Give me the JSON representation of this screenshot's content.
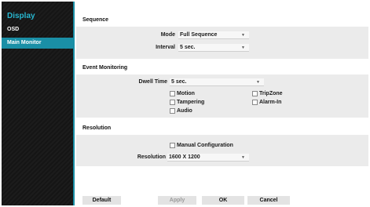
{
  "sidebar": {
    "title": "Display",
    "items": [
      {
        "label": "OSD",
        "active": false
      },
      {
        "label": "Main Monitor",
        "active": true
      }
    ]
  },
  "sequence": {
    "title": "Sequence",
    "mode_label": "Mode",
    "mode_value": "Full Sequence",
    "interval_label": "Interval",
    "interval_value": "5 sec."
  },
  "event_monitoring": {
    "title": "Event Monitoring",
    "dwell_label": "Dwell Time",
    "dwell_value": "5 sec.",
    "options": [
      {
        "label": "Motion",
        "checked": false
      },
      {
        "label": "TripZone",
        "checked": false
      },
      {
        "label": "Tampering",
        "checked": false
      },
      {
        "label": "Alarm-In",
        "checked": false
      },
      {
        "label": "Audio",
        "checked": false
      }
    ]
  },
  "resolution": {
    "title": "Resolution",
    "manual_label": "Manual Configuration",
    "manual_checked": false,
    "resolution_label": "Resolution",
    "resolution_value": "1600 X 1200"
  },
  "footer": {
    "default_label": "Default",
    "apply_label": "Apply",
    "ok_label": "OK",
    "cancel_label": "Cancel"
  },
  "colors": {
    "accent": "#1a8fa6",
    "title": "#27b6cf",
    "sidebar_bg": "#151515"
  },
  "icons": {
    "dropdown": "chevron-down-icon",
    "checkbox": "checkbox-icon"
  }
}
